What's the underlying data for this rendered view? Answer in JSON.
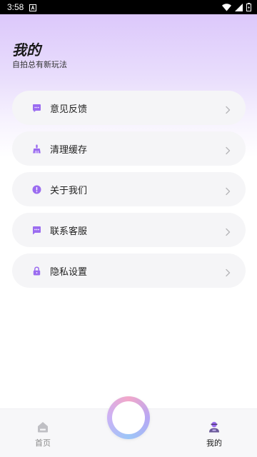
{
  "status_bar": {
    "time": "3:58",
    "notification_icon": "a-box-icon",
    "icons": [
      "wifi-icon",
      "signal-icon",
      "battery-icon"
    ]
  },
  "header": {
    "title": "我的",
    "subtitle": "自拍总有新玩法"
  },
  "menu": {
    "items": [
      {
        "label": "意见反馈",
        "icon": "feedback-icon"
      },
      {
        "label": "清理缓存",
        "icon": "broom-icon"
      },
      {
        "label": "关于我们",
        "icon": "info-icon"
      },
      {
        "label": "联系客服",
        "icon": "chat-icon"
      },
      {
        "label": "隐私设置",
        "icon": "lock-icon"
      }
    ]
  },
  "bottom_nav": {
    "home_label": "首页",
    "mine_label": "我的",
    "home_icon": "home-icon",
    "mine_icon": "profile-icon",
    "center_button_icon": "camera-ring-icon"
  },
  "colors": {
    "accent": "#9b6cf0",
    "header_gradient_top": "#dcc8fb",
    "card_background": "#f5f5f7",
    "status_bar": "#000000"
  }
}
